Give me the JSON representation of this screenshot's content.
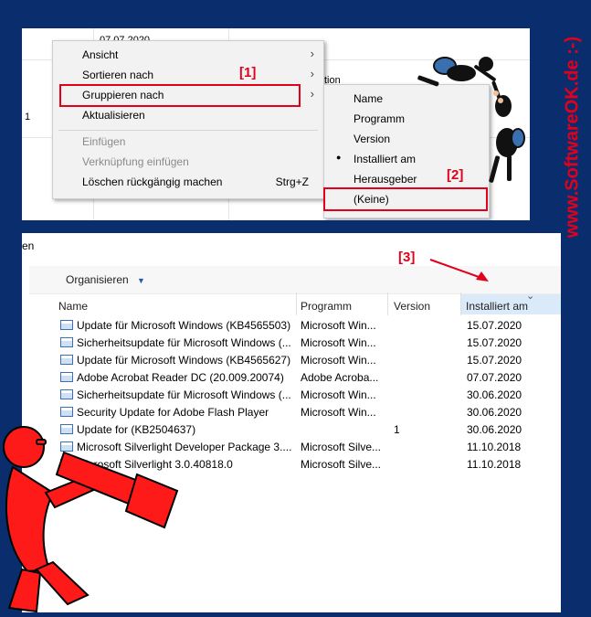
{
  "top_panel": {
    "bg_date": "07.07.2020",
    "bg_text_tion": "tion",
    "bg_text_one": "1"
  },
  "context_menu": {
    "items": [
      {
        "label": "Ansicht"
      },
      {
        "label": "Sortieren nach"
      },
      {
        "label": "Gruppieren nach"
      },
      {
        "label": "Aktualisieren"
      },
      {
        "label": "Einfügen"
      },
      {
        "label": "Verknüpfung einfügen"
      },
      {
        "label": "Löschen rückgängig machen",
        "shortcut": "Strg+Z"
      }
    ]
  },
  "submenu": {
    "items": [
      {
        "label": "Name"
      },
      {
        "label": "Programm"
      },
      {
        "label": "Version"
      },
      {
        "label": "Installiert am"
      },
      {
        "label": "Herausgeber"
      },
      {
        "label": "(Keine)"
      }
    ],
    "bullet": "●"
  },
  "annotations": {
    "label1": "[1]",
    "label2": "[2]",
    "label3": "[3]"
  },
  "watermark": "www.SoftwareOK.de :-)",
  "explorer": {
    "cut_text": "en",
    "toolbar": {
      "organize_label": "Organisieren",
      "organize_arrow": "▼"
    },
    "columns": {
      "name": "Name",
      "program": "Programm",
      "version": "Version",
      "installed": "Installiert am",
      "sort_arrow": "⌄"
    },
    "rows": [
      {
        "name": "Update für Microsoft Windows (KB4565503)",
        "program": "Microsoft Win...",
        "version": "",
        "installed": "15.07.2020"
      },
      {
        "name": "Sicherheitsupdate für Microsoft Windows (...",
        "program": "Microsoft Win...",
        "version": "",
        "installed": "15.07.2020"
      },
      {
        "name": "Update für Microsoft Windows (KB4565627)",
        "program": "Microsoft Win...",
        "version": "",
        "installed": "15.07.2020"
      },
      {
        "name": "Adobe Acrobat Reader DC  (20.009.20074)",
        "program": "Adobe Acroba...",
        "version": "",
        "installed": "07.07.2020"
      },
      {
        "name": "Sicherheitsupdate für Microsoft Windows (...",
        "program": "Microsoft Win...",
        "version": "",
        "installed": "30.06.2020"
      },
      {
        "name": "Security Update for Adobe Flash Player",
        "program": "Microsoft Win...",
        "version": "",
        "installed": "30.06.2020"
      },
      {
        "name": "Update for  (KB2504637)",
        "program": "",
        "version": "1",
        "installed": "30.06.2020"
      },
      {
        "name": "Microsoft Silverlight Developer Package 3....",
        "program": "Microsoft Silve...",
        "version": "",
        "installed": "11.10.2018"
      },
      {
        "name": "Microsoft Silverlight 3.0.40818.0",
        "program": "Microsoft Silve...",
        "version": "",
        "installed": "11.10.2018"
      }
    ]
  },
  "colors": {
    "background": "#0a2d6e",
    "annotation_red": "#e3001b",
    "mascot_red": "#ff1a1a"
  }
}
